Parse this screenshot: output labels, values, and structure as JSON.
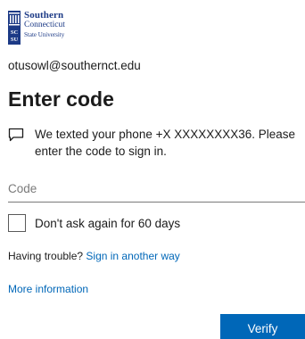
{
  "brand": {
    "line1": "Southern",
    "line2": "Connecticut",
    "line3": "State University",
    "color": "#1c3a86"
  },
  "identity": {
    "email": "otusowl@southernct.edu"
  },
  "title": "Enter code",
  "message": {
    "icon": "chat-message-icon",
    "line1": "We texted your phone +X XXXXXXXX36. Please",
    "line2": "enter the code to sign in."
  },
  "code": {
    "placeholder": "Code",
    "value": ""
  },
  "remember": {
    "label": "Don't ask again for 60 days",
    "checked": false
  },
  "help": {
    "prefix": "Having trouble?",
    "link": "Sign in another way"
  },
  "more_info": "More information",
  "verify": {
    "label": "Verify",
    "color": "#0067b8"
  }
}
